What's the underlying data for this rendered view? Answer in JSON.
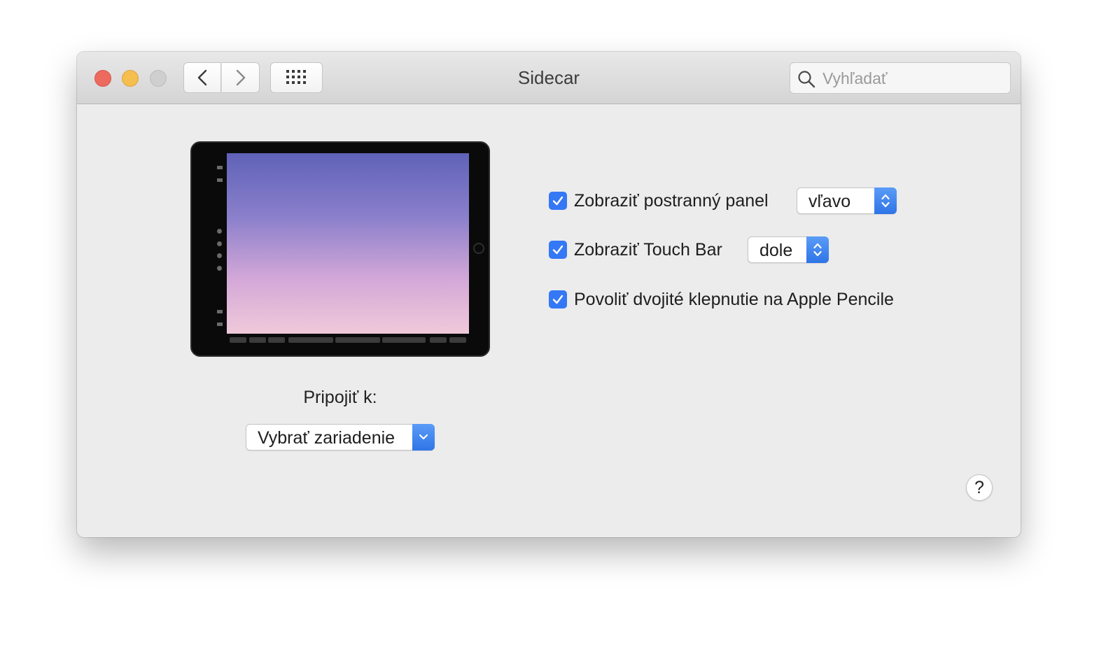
{
  "window": {
    "title": "Sidecar"
  },
  "toolbar": {
    "back_icon": "chevron-left-icon",
    "forward_icon": "chevron-right-icon",
    "show_all_icon": "grid-icon"
  },
  "search": {
    "placeholder": "Vyhľadať",
    "value": "",
    "icon": "search-icon"
  },
  "connect": {
    "label": "Pripojiť k:",
    "device_popup": {
      "selected": "Vybrať zariadenie"
    }
  },
  "options": {
    "sidebar": {
      "checked": true,
      "label": "Zobraziť postranný panel",
      "position": "vľavo"
    },
    "touch_bar": {
      "checked": true,
      "label": "Zobraziť Touch Bar",
      "position": "dole"
    },
    "pencil": {
      "checked": true,
      "label": "Povoliť dvojité klepnutie na Apple Pencile"
    }
  },
  "help": {
    "label": "?"
  },
  "colors": {
    "accent": "#3478f6",
    "close": "#ed6a5e",
    "minimize": "#f5bf4f",
    "zoom_disabled": "#cfcfcf"
  }
}
